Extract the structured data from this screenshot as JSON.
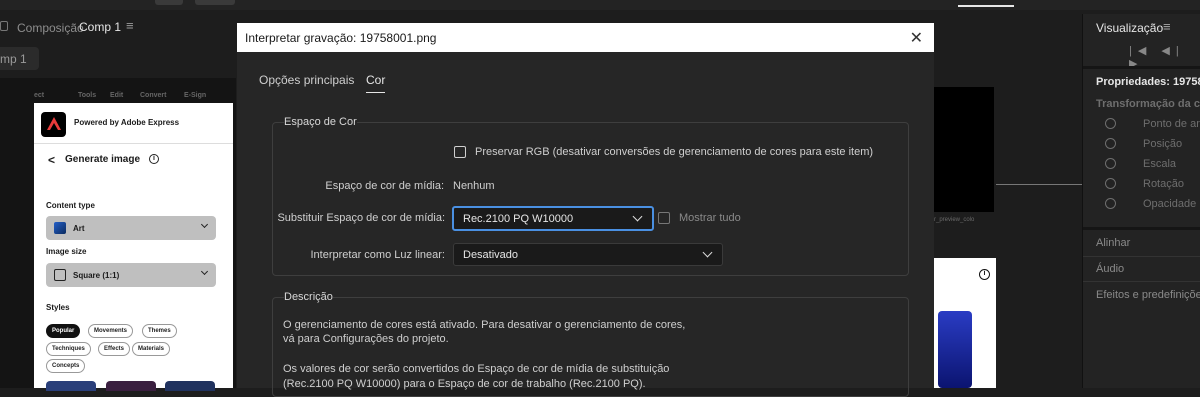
{
  "background": {
    "composition_label": "Composição",
    "composition_name": "Comp 1",
    "comp_tab": "mp 1",
    "menu_glyph": "≡"
  },
  "express": {
    "menubar": [
      "ect",
      "Tools",
      "Edit",
      "Convert",
      "E-Sign"
    ],
    "powered_by": "Powered by Adobe Express",
    "back_glyph": "<",
    "title": "Generate image",
    "info_glyph": "i",
    "content_type_label": "Content type",
    "content_type_value": "Art",
    "image_size_label": "Image size",
    "image_size_value": "Square (1:1)",
    "styles_label": "Styles",
    "chips": [
      "Popular",
      "Movements",
      "Themes",
      "Techniques",
      "Effects",
      "Materials",
      "Concepts"
    ],
    "active_chip": "Popular"
  },
  "viewer": {
    "partial_text": "r_preview_colo",
    "info_glyph": "i"
  },
  "right_panel": {
    "title": "Visualização",
    "menu_glyph": "≡",
    "controls": "|◀ ◀| ▶",
    "properties": "Propriedades: 19758",
    "transform": "Transformação da ca",
    "rows": [
      "Ponto de an",
      "Posição",
      "Escala",
      "Rotação",
      "Opacidade"
    ],
    "sections": [
      "Alinhar",
      "Áudio",
      "Efeitos e predefinições"
    ]
  },
  "dialog": {
    "title": "Interpretar gravação: 19758001.png",
    "close_glyph": "✕",
    "tabs": [
      "Opções principais",
      "Cor"
    ],
    "active_tab": "Cor",
    "color_space": {
      "group_label": "Espaço de Cor",
      "preserve_rgb": "Preservar RGB (desativar conversões de gerenciamento de cores para este item)",
      "media_label": "Espaço de cor de mídia:",
      "media_value": "Nenhum",
      "override_label": "Substituir Espaço de cor de mídia:",
      "override_value": "Rec.2100 PQ W10000",
      "show_all": "Mostrar tudo",
      "linear_label": "Interpretar como Luz linear:",
      "linear_value": "Desativado"
    },
    "description": {
      "group_label": "Descrição",
      "line1": "O gerenciamento de cores está ativado. Para desativar o gerenciamento de cores,",
      "line2": "vá para Configurações do projeto.",
      "line3": "Os valores de cor serão convertidos do Espaço de cor de mídia de substituição",
      "line4": "(Rec.2100 PQ W10000) para o Espaço de cor de trabalho (Rec.2100 PQ)."
    }
  },
  "colors": {
    "accent": "#4a90e2",
    "dialog_bg": "#262626",
    "app_bg": "#1d1d1d"
  }
}
